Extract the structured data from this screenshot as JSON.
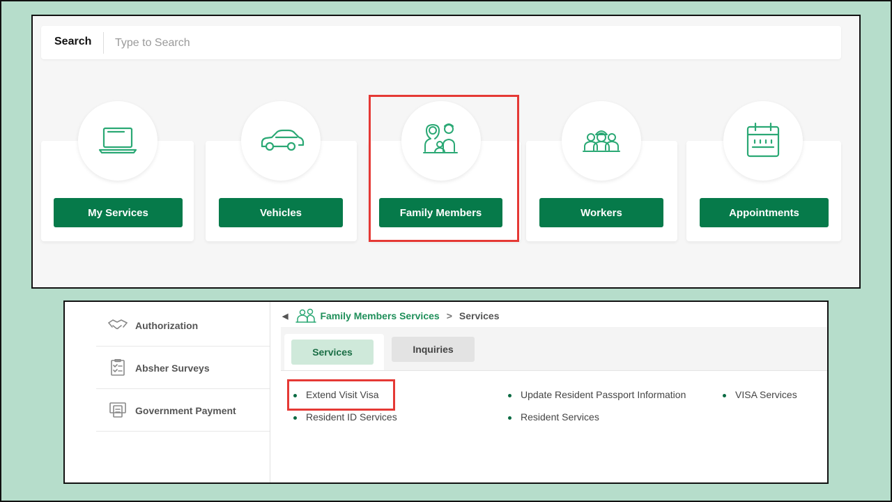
{
  "search": {
    "label": "Search",
    "placeholder": "Type to Search"
  },
  "categories": [
    {
      "label": "My Services",
      "icon": "laptop-icon"
    },
    {
      "label": "Vehicles",
      "icon": "car-icon"
    },
    {
      "label": "Family Members",
      "icon": "family-icon",
      "highlighted": true
    },
    {
      "label": "Workers",
      "icon": "workers-icon"
    },
    {
      "label": "Appointments",
      "icon": "calendar-icon"
    }
  ],
  "sidebar": {
    "items": [
      {
        "label": "Authorization",
        "icon": "handshake-icon"
      },
      {
        "label": "Absher Surveys",
        "icon": "survey-icon"
      },
      {
        "label": "Government Payment",
        "icon": "payment-icon"
      }
    ]
  },
  "breadcrumb": {
    "link": "Family Members Services",
    "separator": ">",
    "current": "Services",
    "back": "◀"
  },
  "tabs": {
    "services": "Services",
    "inquiries": "Inquiries"
  },
  "services": [
    {
      "label": "Extend Visit Visa",
      "highlighted": true
    },
    {
      "label": "Update Resident Passport Information"
    },
    {
      "label": "VISA Services"
    },
    {
      "label": "Resident ID Services"
    },
    {
      "label": "Resident Services"
    }
  ],
  "colors": {
    "brand_green": "#067a4a",
    "highlight_red": "#e53935",
    "background": "#b6ddcb"
  }
}
